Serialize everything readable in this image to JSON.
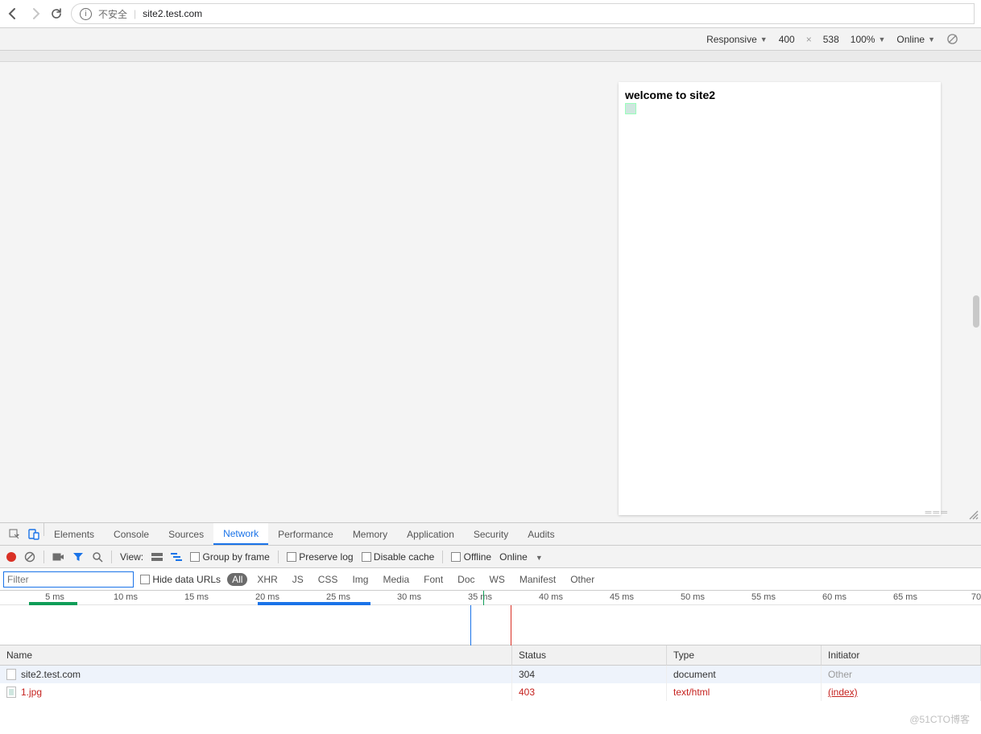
{
  "browser": {
    "insecure_label": "不安全",
    "url": "site2.test.com"
  },
  "device_bar": {
    "mode": "Responsive",
    "width": "400",
    "height": "538",
    "zoom": "100%",
    "throttle": "Online"
  },
  "page": {
    "heading": "welcome to site2"
  },
  "devtools": {
    "tabs": [
      "Elements",
      "Console",
      "Sources",
      "Network",
      "Performance",
      "Memory",
      "Application",
      "Security",
      "Audits"
    ],
    "active_tab": "Network"
  },
  "net_toolbar": {
    "view_label": "View:",
    "group_by_frame": "Group by frame",
    "preserve_log": "Preserve log",
    "disable_cache": "Disable cache",
    "offline": "Offline",
    "online": "Online"
  },
  "filter": {
    "placeholder": "Filter",
    "hide_data_urls": "Hide data URLs",
    "types": [
      "All",
      "XHR",
      "JS",
      "CSS",
      "Img",
      "Media",
      "Font",
      "Doc",
      "WS",
      "Manifest",
      "Other"
    ]
  },
  "timeline": {
    "ticks": [
      "5 ms",
      "10 ms",
      "15 ms",
      "20 ms",
      "25 ms",
      "30 ms",
      "35 ms",
      "40 ms",
      "45 ms",
      "50 ms",
      "55 ms",
      "60 ms",
      "65 ms",
      "70"
    ]
  },
  "table": {
    "headers": [
      "Name",
      "Status",
      "Type",
      "Initiator"
    ],
    "rows": [
      {
        "name": "site2.test.com",
        "status": "304",
        "type": "document",
        "initiator": "Other",
        "error": false,
        "initiator_muted": true
      },
      {
        "name": "1.jpg",
        "status": "403",
        "type": "text/html",
        "initiator": "(index)",
        "error": true,
        "initiator_muted": false
      }
    ]
  },
  "watermark": "@51CTO博客"
}
